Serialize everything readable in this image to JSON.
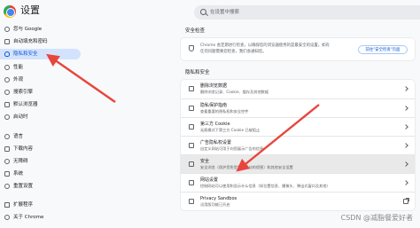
{
  "app": {
    "title": "设置"
  },
  "search": {
    "placeholder": "在设置中搜索"
  },
  "sidebar": {
    "items": [
      {
        "label": "您与 Google",
        "icon": "person-icon"
      },
      {
        "label": "自动填充和密码",
        "icon": "autofill-icon"
      },
      {
        "label": "隐私和安全",
        "icon": "shield-icon",
        "active": true
      },
      {
        "label": "性能",
        "icon": "speed-icon"
      },
      {
        "label": "外观",
        "icon": "palette-icon"
      },
      {
        "label": "搜索引擎",
        "icon": "search-icon"
      },
      {
        "label": "默认浏览器",
        "icon": "browser-icon"
      },
      {
        "label": "启动时",
        "icon": "power-icon"
      },
      {
        "label": "语言",
        "icon": "language-icon"
      },
      {
        "label": "下载内容",
        "icon": "download-icon"
      },
      {
        "label": "无障碍",
        "icon": "accessibility-icon"
      },
      {
        "label": "系统",
        "icon": "wrench-icon"
      },
      {
        "label": "重置设置",
        "icon": "reset-icon"
      },
      {
        "label": "扩展程序",
        "icon": "extension-icon"
      },
      {
        "label": "关于 Chrome",
        "icon": "chrome-icon"
      }
    ]
  },
  "safety_check": {
    "heading": "安全检查",
    "text": "Chrome 会定期进行检查，以确保您的浏览器使用的是最安全的设置。如有任何问题需要您检查，我们会通知您。",
    "button": "前往\"安全检查\"页面"
  },
  "privacy": {
    "heading": "隐私和安全",
    "rows": [
      {
        "title": "删除浏览数据",
        "desc": "删除浏览记录、Cookie、缓存及其他数据",
        "action": "chevron"
      },
      {
        "title": "隐私保护指南",
        "desc": "查看重要的隐私权和安全控件",
        "action": "chevron"
      },
      {
        "title": "第三方 Cookie",
        "desc": "无痕模式下第三方 Cookie 已被阻止",
        "action": "chevron"
      },
      {
        "title": "广告隐私权设置",
        "desc": "自定义网站可用于向您展示广告的信息",
        "action": "chevron"
      },
      {
        "title": "安全",
        "desc": "安全浏览（保护您免受危险网站的侵害）和其他安全设置",
        "action": "chevron",
        "highlighted": true
      },
      {
        "title": "网站设置",
        "desc": "控制网站可以使用和显示什么信息（如位置信息、摄像头、弹出式窗口及其他）",
        "action": "chevron"
      },
      {
        "title": "Privacy Sandbox",
        "desc": "试用版功能已开启",
        "action": "external"
      }
    ]
  },
  "watermark": "CSDN @减脂餐爱好者",
  "colors": {
    "accent": "#0b57d0",
    "active_bg": "#d3e3fd",
    "arrow": "#e8453c"
  }
}
